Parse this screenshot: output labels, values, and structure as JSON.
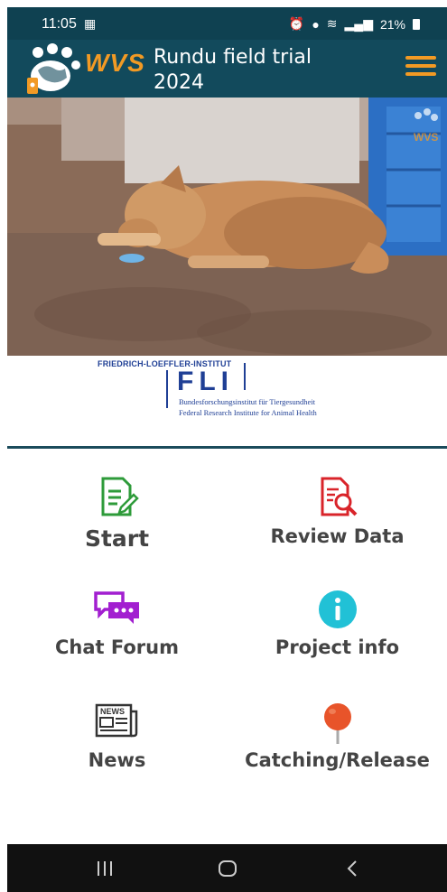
{
  "status_bar": {
    "time": "11:05",
    "sim_icon": "sim-card-icon",
    "alarm_icon": "alarm-icon",
    "location_icon": "location-icon",
    "wifi_icon": "wifi-icon",
    "signal_icon": "signal-icon",
    "battery_percent": "21%"
  },
  "app_bar": {
    "logo_text": "WVS",
    "title": "Rundu field trial 2024",
    "menu_icon": "hamburger-menu-icon",
    "accent_color": "#f29a24",
    "bg_color": "#124a5c"
  },
  "hero": {
    "watermark_text": "WVS"
  },
  "partner_logo": {
    "institute_top": "FRIEDRICH-LOEFFLER-INSTITUT",
    "abbreviation": "FLI",
    "subtitle_de": "Bundesforschungsinstitut für Tiergesundheit",
    "subtitle_en": "Federal Research Institute for Animal Health"
  },
  "menu": {
    "items": [
      {
        "label": "Start",
        "icon": "document-edit-icon",
        "color": "#2e9b3a"
      },
      {
        "label": "Review Data",
        "icon": "document-search-icon",
        "color": "#d9242a"
      },
      {
        "label": "Chat Forum",
        "icon": "chat-bubbles-icon",
        "color": "#a21fd0"
      },
      {
        "label": "Project info",
        "icon": "info-icon",
        "color": "#21c1d6"
      },
      {
        "label": "News",
        "icon": "newspaper-icon",
        "color": "#333333"
      },
      {
        "label": "Catching/Release",
        "icon": "map-pin-icon",
        "color": "#e8542a"
      }
    ]
  },
  "nav_bar": {
    "recents_icon": "recents-icon",
    "home_icon": "home-icon",
    "back_icon": "back-icon"
  }
}
